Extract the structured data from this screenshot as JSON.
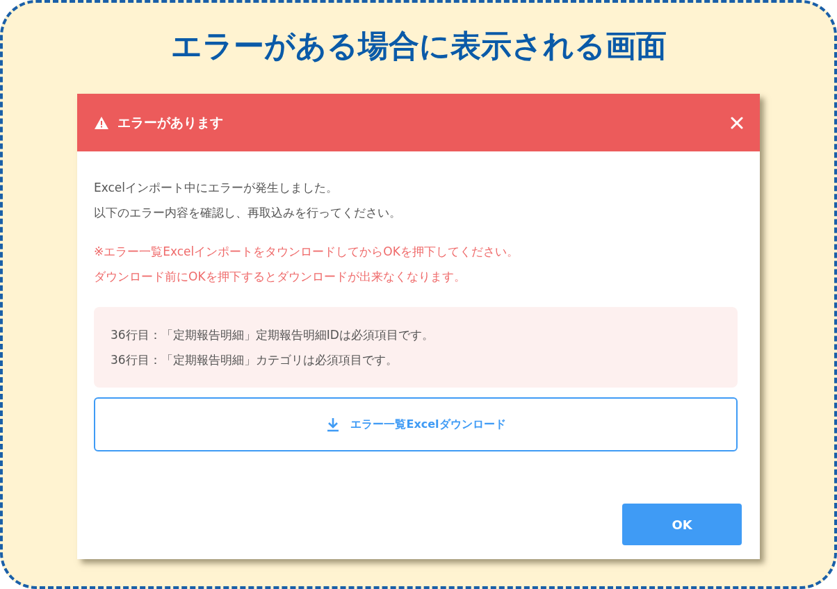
{
  "banner": {
    "title": "エラーがある場合に表示される画面"
  },
  "dialog": {
    "title": "エラーがあります",
    "message_lines": [
      "Excelインポート中にエラーが発生しました。",
      "以下のエラー内容を確認し、再取込みを行ってください。"
    ],
    "warning_lines": [
      "※エラー一覧ExcelインポートをタウンロードしてからOKを押下してください。",
      "ダウンロード前にOKを押下するとダウンロードが出来なくなります。"
    ],
    "errors": [
      "36行目：「定期報告明細」定期報告明細IDは必須項目です。",
      "36行目：「定期報告明細」カテゴリは必須項目です。"
    ],
    "download_button": "エラー一覧Excelダウンロード",
    "ok_button": "OK"
  }
}
